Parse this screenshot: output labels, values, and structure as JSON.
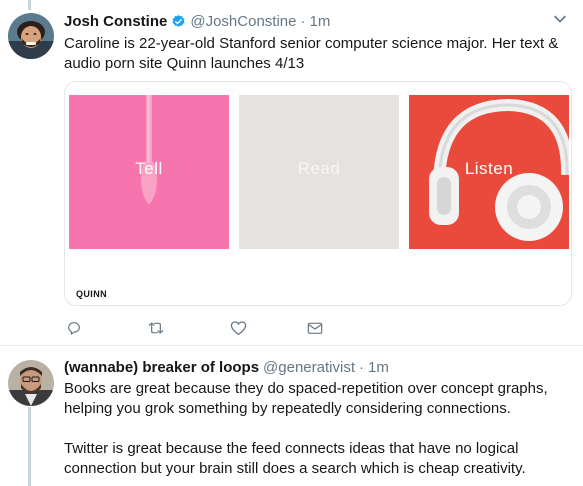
{
  "tweets": [
    {
      "author_name": "Josh Constine",
      "verified": true,
      "handle": "@JoshConstine",
      "separator": "·",
      "time": "1m",
      "text": "Caroline is 22-year-old Stanford senior computer science major. Her text & audio porn site Quinn launches 4/13",
      "card": {
        "panels": [
          {
            "label": "Tell",
            "color": "#f775ae"
          },
          {
            "label": "Read",
            "color": "#e5e3df"
          },
          {
            "label": "Listen",
            "color": "#ea4a3c"
          }
        ],
        "brand": "QUINN"
      },
      "actions": [
        "reply-icon",
        "retweet-icon",
        "like-icon",
        "direct-message-icon"
      ]
    },
    {
      "author_name": "(wannabe) breaker of loops",
      "handle": "@generativist",
      "separator": "·",
      "time": "1m",
      "paragraphs": [
        "Books are great because they do spaced-repetition over concept graphs, helping you grok something by repeatedly considering connections.",
        "Twitter is great because the feed connects ideas that have no logical connection but your brain still does a search which is cheap creativity."
      ]
    }
  ],
  "colors": {
    "accent": "#1da1f2",
    "secondary_text": "#657786",
    "icon": "#657786"
  }
}
